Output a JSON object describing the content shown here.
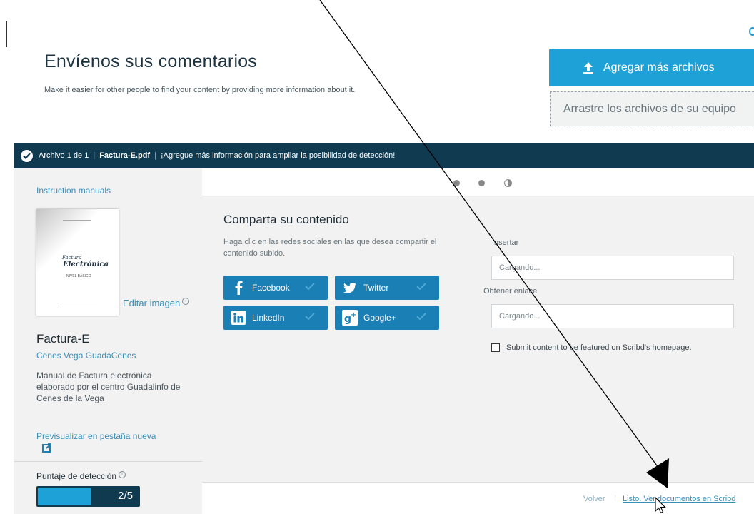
{
  "header": {
    "title": "Envíenos sus comentarios",
    "subtitle": "Make it easier for other people to find your content by providing more information about it."
  },
  "upload": {
    "add_more_label": "Agregar más archivos",
    "drop_label": "Arrastre los archivos de su equipo"
  },
  "info_bar": {
    "file_count": "Archivo 1 de 1",
    "file_name": "Factura-E.pdf",
    "message": "¡Agregue más información para ampliar la posibilidad de detección!"
  },
  "sidebar": {
    "category": "Instruction manuals",
    "thumb_title_small": "Factura",
    "thumb_title_big": "Electrónica",
    "thumb_level": "NIVEL BÁSICO",
    "edit_image": "Editar imagen",
    "doc_title": "Factura-E",
    "author": "Cenes Vega GuadaCenes",
    "description": "Manual de Factura electrónica elaborado por el centro Guadalinfo de Cenes de la Vega",
    "preview_link": "Previsualizar en pestaña nueva",
    "score_label": "Puntaje de detección",
    "score_text": "2/5",
    "score_fraction": 0.53
  },
  "share": {
    "title": "Comparta su contenido",
    "help": "Haga clic en las redes sociales en las que desea compartir el contenido subido.",
    "buttons": [
      {
        "label": "Facebook",
        "icon": "facebook-icon"
      },
      {
        "label": "Twitter",
        "icon": "twitter-icon"
      },
      {
        "label": "LinkedIn",
        "icon": "linkedin-icon"
      },
      {
        "label": "Google+",
        "icon": "google-plus-icon"
      }
    ],
    "embed_label": "Insertar",
    "embed_value": "Cargando...",
    "link_label": "Obtener enlace",
    "link_value": "Cargando...",
    "feature_label": "Submit content to be featured on Scribd's homepage."
  },
  "footer": {
    "back_label": "Volver",
    "separator": "|",
    "done_label": "Listo. Ver documentos en Scribd"
  },
  "colors": {
    "accent": "#1da1d6",
    "dark_bar": "#0f3a50",
    "social": "#1a7fb5",
    "link": "#3a8fb7"
  }
}
